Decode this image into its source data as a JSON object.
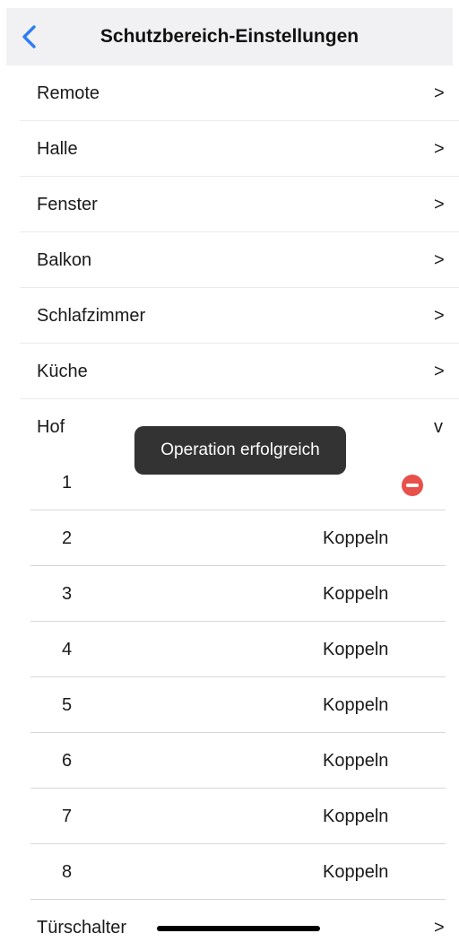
{
  "nav": {
    "title": "Schutzbereich-Einstellungen",
    "back_icon": "chevron-left-icon",
    "accent_color": "#2f7cf6"
  },
  "zones": [
    {
      "label": "Remote",
      "indicator": ">"
    },
    {
      "label": "Halle",
      "indicator": ">"
    },
    {
      "label": "Fenster",
      "indicator": ">"
    },
    {
      "label": "Balkon",
      "indicator": ">"
    },
    {
      "label": "Schlafzimmer",
      "indicator": ">"
    },
    {
      "label": "Küche",
      "indicator": ">"
    },
    {
      "label": "Hof",
      "indicator": "v"
    }
  ],
  "hof_slots": [
    {
      "number": "1",
      "action": "",
      "icon": "remove-icon"
    },
    {
      "number": "2",
      "action": "Koppeln"
    },
    {
      "number": "3",
      "action": "Koppeln"
    },
    {
      "number": "4",
      "action": "Koppeln"
    },
    {
      "number": "5",
      "action": "Koppeln"
    },
    {
      "number": "6",
      "action": "Koppeln"
    },
    {
      "number": "7",
      "action": "Koppeln"
    },
    {
      "number": "8",
      "action": "Koppeln"
    }
  ],
  "last_zone": {
    "label": "Türschalter",
    "indicator": ">"
  },
  "toast": {
    "text": "Operation erfolgreich"
  },
  "colors": {
    "remove": "#e8504a",
    "toast_bg": "#333333"
  }
}
